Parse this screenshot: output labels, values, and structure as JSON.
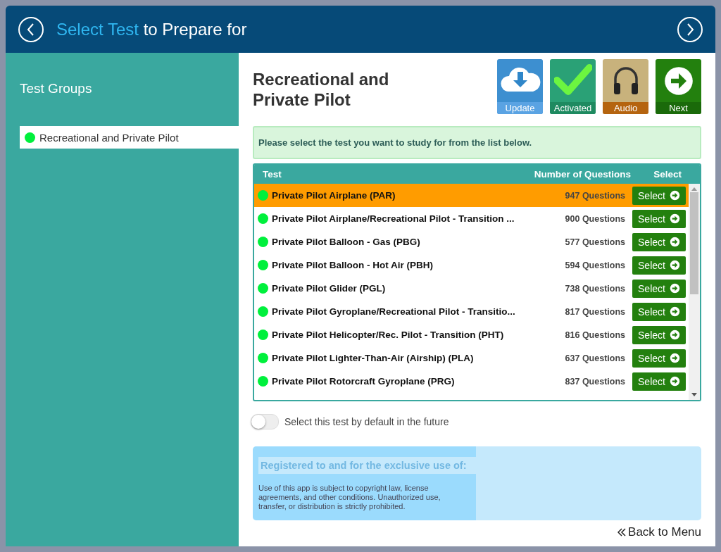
{
  "header": {
    "title_accent": "Select Test",
    "title_rest": "to Prepare for"
  },
  "sidebar": {
    "title": "Test Groups",
    "items": [
      {
        "label": "Recreational and Private Pilot",
        "selected": true
      }
    ]
  },
  "group_title": "Recreational and Private Pilot",
  "actions": [
    {
      "kind": "update",
      "label": "Update"
    },
    {
      "kind": "activated",
      "label": "Activated"
    },
    {
      "kind": "audio",
      "label": "Audio"
    },
    {
      "kind": "next",
      "label": "Next"
    }
  ],
  "instruction": "Please select the test you want to study for from the list below.",
  "table": {
    "columns": [
      "Test",
      "Number of Questions",
      "Select"
    ],
    "rows": [
      {
        "name": "Private Pilot Airplane (PAR)",
        "questions": "947 Questions",
        "button": "Select",
        "selected": true
      },
      {
        "name": "Private Pilot Airplane/Recreational Pilot - Transition ...",
        "questions": "900 Questions",
        "button": "Select",
        "selected": false
      },
      {
        "name": "Private Pilot Balloon - Gas (PBG)",
        "questions": "577 Questions",
        "button": "Select",
        "selected": false
      },
      {
        "name": "Private Pilot Balloon - Hot Air (PBH)",
        "questions": "594 Questions",
        "button": "Select",
        "selected": false
      },
      {
        "name": "Private Pilot Glider (PGL)",
        "questions": "738 Questions",
        "button": "Select",
        "selected": false
      },
      {
        "name": "Private Pilot Gyroplane/Recreational Pilot - Transitio...",
        "questions": "817 Questions",
        "button": "Select",
        "selected": false
      },
      {
        "name": "Private Pilot Helicopter/Rec. Pilot - Transition (PHT)",
        "questions": "816 Questions",
        "button": "Select",
        "selected": false
      },
      {
        "name": "Private Pilot Lighter-Than-Air (Airship) (PLA)",
        "questions": "637 Questions",
        "button": "Select",
        "selected": false
      },
      {
        "name": "Private Pilot Rotorcraft Gyroplane (PRG)",
        "questions": "837 Questions",
        "button": "Select",
        "selected": false
      }
    ]
  },
  "default_toggle": {
    "label": "Select this test by default in the future",
    "on": false
  },
  "registration": {
    "heading": "Registered to and for the exclusive use of:",
    "notice": "Use of this app is subject to copyright law, license agreements, and other conditions. Unauthorized use, transfer, or distribution is strictly prohibited."
  },
  "back_link": "Back to Menu"
}
